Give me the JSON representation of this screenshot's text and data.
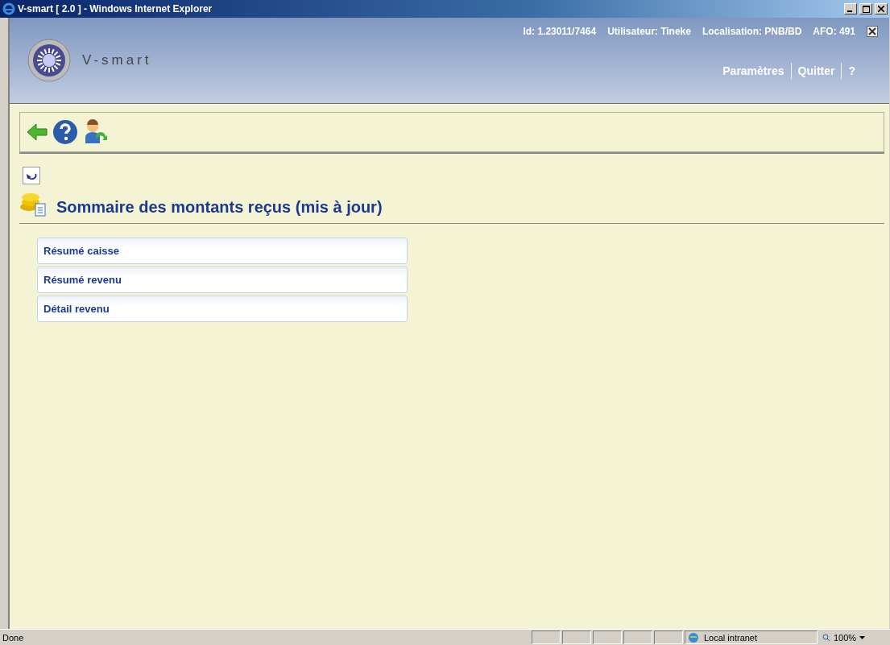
{
  "window": {
    "title": "V-smart [ 2.0 ] - Windows Internet Explorer"
  },
  "header": {
    "logo_text": "V-smart",
    "info": [
      {
        "text": "Id: 1.23011/7464"
      },
      {
        "text": "Utilisateur: Tineke"
      },
      {
        "text": "Localisation: PNB/BD"
      },
      {
        "text": "AFO: 491"
      }
    ],
    "links": [
      {
        "label": "Paramètres"
      },
      {
        "label": "Quitter"
      },
      {
        "label": "?"
      }
    ]
  },
  "page": {
    "title": "Sommaire des montants reçus (mis à jour)",
    "menu": [
      {
        "label": "Résumé caisse"
      },
      {
        "label": "Résumé revenu"
      },
      {
        "label": "Détail revenu"
      }
    ]
  },
  "status_bar": {
    "status": "Done",
    "zone": "Local intranet",
    "zoom": "100%"
  }
}
